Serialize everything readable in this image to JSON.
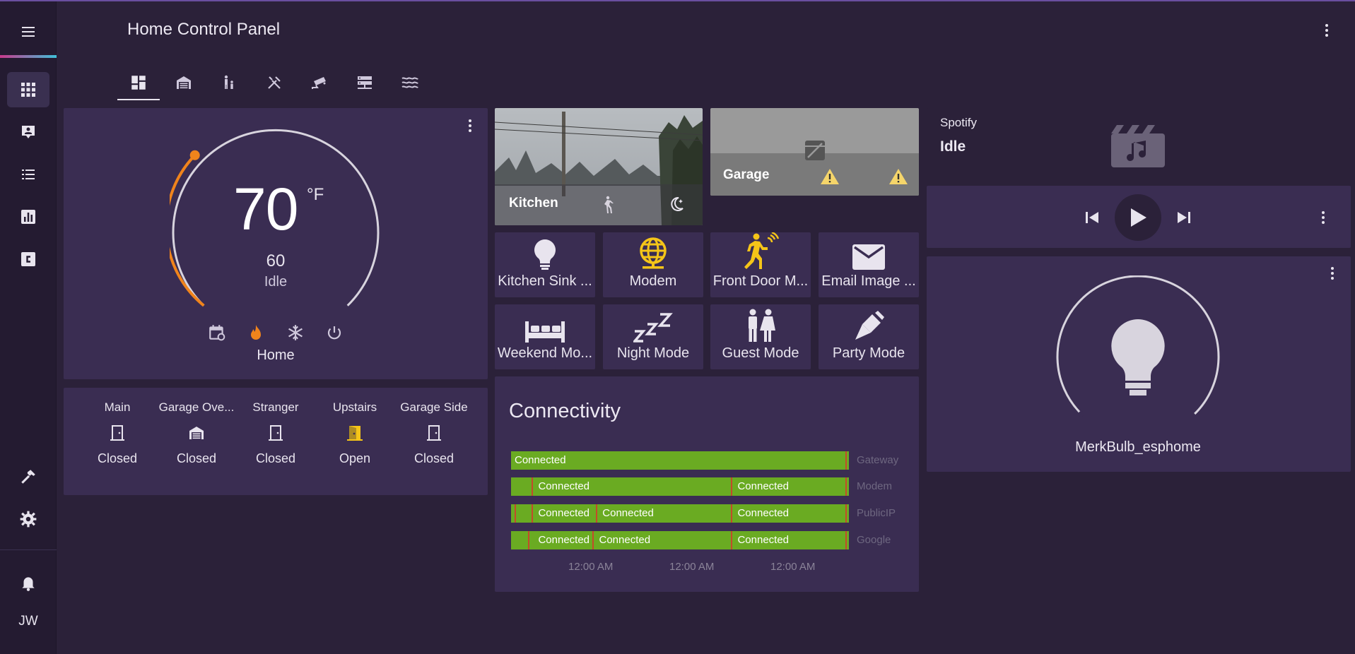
{
  "app": {
    "title": "Home Control Panel",
    "user_initials": "JW"
  },
  "sidebar": {
    "items": [
      {
        "icon": "menu-icon"
      },
      {
        "icon": "grid-icon"
      },
      {
        "icon": "contact-card-icon"
      },
      {
        "icon": "list-icon"
      },
      {
        "icon": "chart-icon"
      },
      {
        "icon": "c-box-icon"
      },
      {
        "icon": "hammer-icon"
      },
      {
        "icon": "gear-icon"
      },
      {
        "icon": "bell-icon"
      }
    ]
  },
  "tabs": [
    {
      "icon": "dashboard-icon",
      "active": true
    },
    {
      "icon": "garage-icon"
    },
    {
      "icon": "family-icon"
    },
    {
      "icon": "utensils-icon"
    },
    {
      "icon": "cctv-icon"
    },
    {
      "icon": "server-icon"
    },
    {
      "icon": "waves-icon"
    }
  ],
  "thermostat": {
    "current": "70",
    "unit": "°F",
    "target": "60",
    "state": "Idle",
    "preset": "Home",
    "modes": [
      "calendar-sync-icon",
      "flame-icon",
      "snowflake-icon",
      "power-icon"
    ]
  },
  "doors": [
    {
      "name": "Main",
      "state": "Closed",
      "icon": "door-closed-icon",
      "color": "#e8e4ee"
    },
    {
      "name": "Garage Ove...",
      "state": "Closed",
      "icon": "garage-closed-icon",
      "color": "#e8e4ee"
    },
    {
      "name": "Stranger",
      "state": "Closed",
      "icon": "door-closed-icon",
      "color": "#e8e4ee"
    },
    {
      "name": "Upstairs",
      "state": "Open",
      "icon": "door-open-icon",
      "color": "#f5c518"
    },
    {
      "name": "Garage Side",
      "state": "Closed",
      "icon": "door-closed-icon",
      "color": "#e8e4ee"
    }
  ],
  "cameras": [
    {
      "name": "Kitchen",
      "icons": [
        "walk-icon",
        "moon-icon"
      ]
    },
    {
      "name": "Garage",
      "icons": [
        "camera-off-icon",
        "warning-icon",
        "warning-icon"
      ]
    }
  ],
  "tiles": [
    {
      "label": "Kitchen Sink ...",
      "icon": "bulb-icon",
      "color": "#e8e4ee"
    },
    {
      "label": "Modem",
      "icon": "globe-icon",
      "color": "#f5c518"
    },
    {
      "label": "Front Door M...",
      "icon": "motion-sensor-icon",
      "color": "#f5c518"
    },
    {
      "label": "Email Image ...",
      "icon": "email-icon",
      "color": "#e8e4ee"
    },
    {
      "label": "Weekend Mo...",
      "icon": "bed-icon",
      "color": "#e8e4ee"
    },
    {
      "label": "Night Mode",
      "icon": "sleep-icon",
      "color": "#e8e4ee"
    },
    {
      "label": "Guest Mode",
      "icon": "human-male-female-icon",
      "color": "#e8e4ee"
    },
    {
      "label": "Party Mode",
      "icon": "party-popper-icon",
      "color": "#e8e4ee"
    }
  ],
  "connectivity": {
    "title": "Connectivity",
    "rows": [
      {
        "name": "Gateway",
        "segments": [
          {
            "label": "Connected",
            "start": 0.0
          }
        ],
        "marks": [
          0.99
        ]
      },
      {
        "name": "Modem",
        "segments": [
          {
            "label": "Connected",
            "start": 0.07
          },
          {
            "label": "Connected",
            "start": 0.66
          }
        ],
        "marks": [
          0.06,
          0.65,
          0.99
        ]
      },
      {
        "name": "PublicIP",
        "segments": [
          {
            "label": "Connected",
            "start": 0.07
          },
          {
            "label": "Connected",
            "start": 0.26
          },
          {
            "label": "Connected",
            "start": 0.66
          }
        ],
        "marks": [
          0.01,
          0.06,
          0.25,
          0.65,
          0.99
        ]
      },
      {
        "name": "Google",
        "segments": [
          {
            "label": "Connected",
            "start": 0.07
          },
          {
            "label": "Connected",
            "start": 0.25
          },
          {
            "label": "Connected",
            "start": 0.66
          }
        ],
        "marks": [
          0.05,
          0.24,
          0.65,
          0.99
        ]
      }
    ],
    "axis": [
      "12:00 AM",
      "12:00 AM",
      "12:00 AM"
    ],
    "bar_color": "#6aab22",
    "mark_color": "#c44a2a"
  },
  "media": {
    "app": "Spotify",
    "state": "Idle",
    "controls": [
      "skip-previous-icon",
      "play-icon",
      "skip-next-icon"
    ]
  },
  "light": {
    "name": "MerkBulb_esphome"
  }
}
